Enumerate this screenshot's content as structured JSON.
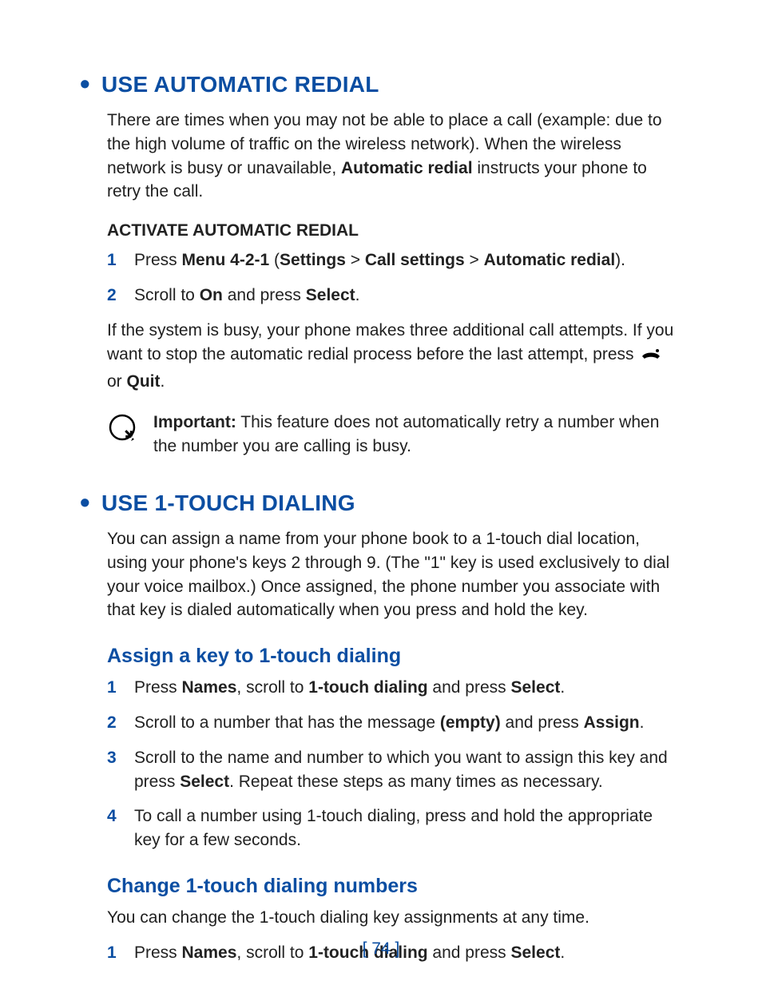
{
  "section1": {
    "title": "USE AUTOMATIC REDIAL",
    "intro_parts": [
      "There are times when you may not be able to place a call (example: due to the high volume of traffic on the wireless network). When the wireless network is busy or unavailable, ",
      "Automatic redial",
      " instructs your phone to retry the call."
    ],
    "sub_heading": "ACTIVATE AUTOMATIC REDIAL",
    "steps": [
      {
        "num": "1",
        "parts": [
          "Press ",
          "Menu 4-2-1",
          " (",
          "Settings",
          " > ",
          "Call settings",
          " > ",
          "Automatic redial",
          ")."
        ]
      },
      {
        "num": "2",
        "parts": [
          "Scroll to ",
          "On",
          " and press ",
          "Select",
          "."
        ]
      }
    ],
    "after_parts": [
      "If the system is busy, your phone makes three additional call attempts. If you want to stop the automatic redial process before the last attempt, press ",
      " or ",
      "Quit",
      "."
    ],
    "note_parts": [
      "Important:",
      " This feature does not automatically retry a number when the number you are calling is busy."
    ]
  },
  "section2": {
    "title": "USE 1-TOUCH DIALING",
    "intro": "You can assign a name from your phone book to a 1-touch dial location, using your phone's keys 2 through 9. (The \"1\" key is used exclusively to dial your voice mailbox.) Once assigned, the phone number you associate with that key is dialed automatically when you press and hold the key.",
    "sub1": {
      "heading": "Assign a key to 1-touch dialing",
      "steps": [
        {
          "num": "1",
          "parts": [
            "Press ",
            "Names",
            ", scroll to ",
            "1-touch dialing",
            " and press ",
            "Select",
            "."
          ]
        },
        {
          "num": "2",
          "parts": [
            "Scroll to a number that has the message ",
            "(empty)",
            " and press ",
            "Assign",
            "."
          ]
        },
        {
          "num": "3",
          "parts": [
            "Scroll to the name and number to which you want to assign this key and press ",
            "Select",
            ". Repeat these steps as many times as necessary."
          ]
        },
        {
          "num": "4",
          "parts": [
            "To call a number using 1-touch dialing, press and hold the appropriate key for a few seconds."
          ]
        }
      ]
    },
    "sub2": {
      "heading": "Change 1-touch dialing numbers",
      "intro": "You can change the 1-touch dialing key assignments at any time.",
      "steps": [
        {
          "num": "1",
          "parts": [
            "Press ",
            "Names",
            ", scroll to ",
            "1-touch dialing",
            " and press ",
            "Select",
            "."
          ]
        }
      ]
    }
  },
  "page_number": "[ 74 ]"
}
